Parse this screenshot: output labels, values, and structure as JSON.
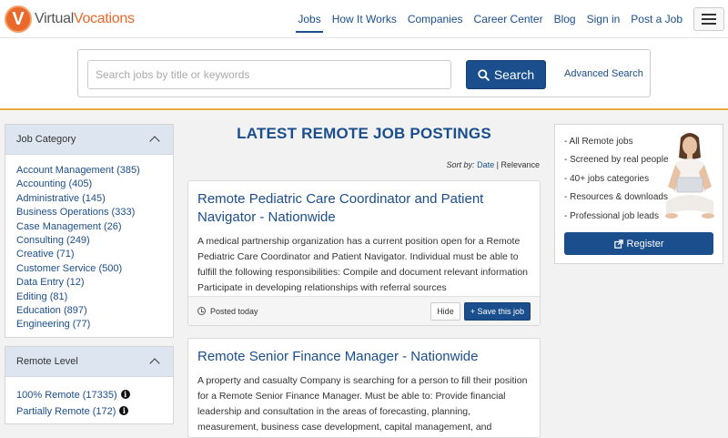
{
  "header": {
    "logo_letter": "V",
    "logo_virtual": "Virtual",
    "logo_vocations": "Vocations",
    "nav": [
      "Jobs",
      "How It Works",
      "Companies",
      "Career Center",
      "Blog",
      "Sign in",
      "Post a Job"
    ],
    "active_nav": "Jobs",
    "menu_icon": "hamburger-icon"
  },
  "search": {
    "placeholder": "Search jobs by title or keywords",
    "value": "",
    "button_label": "Search",
    "button_icon": "search-icon",
    "advanced_label": "Advanced Search"
  },
  "sidebar": {
    "category_title": "Job Category",
    "categories": [
      "Account Management (385)",
      "Accounting (405)",
      "Administrative (145)",
      "Business Operations (333)",
      "Case Management (26)",
      "Consulting (249)",
      "Creative (71)",
      "Customer Service (500)",
      "Data Entry (12)",
      "Editing (81)",
      "Education (897)",
      "Engineering (77)"
    ],
    "remote_title": "Remote Level",
    "remote_levels": [
      "100% Remote (17335)",
      "Partially Remote (172)"
    ],
    "info_glyph": "i"
  },
  "main": {
    "title": "LATEST REMOTE JOB POSTINGS",
    "sort_label": "Sort by:",
    "sort_options": [
      "Date",
      "Relevance"
    ],
    "sort_separator": "|",
    "jobs": [
      {
        "title": "Remote Pediatric Care Coordinator and Patient Navigator - Nationwide",
        "description": "A medical partnership organization has a current position open for a Remote Pediatric Care Coordinator and Patient Navigator. Individual must be able to fulfill the following responsibilities: Compile and document relevant information Participate in developing relationships with referral sources",
        "posted": "Posted today",
        "hide_label": "Hide",
        "save_label": "+ Save this job"
      },
      {
        "title": "Remote Senior Finance Manager - Nationwide",
        "description": "A property and casualty Company is searching for a person to fill their position for a Remote Senior Finance Manager. Must be able to: Provide financial leadership and consultation in the areas of forecasting, planning, measurement, business case development, capital management, and"
      }
    ]
  },
  "promo": {
    "items": [
      "- All Remote jobs",
      "- Screened by real people",
      "- 40+ jobs categories",
      "- Resources & downloads",
      "- Professional job leads"
    ],
    "register_label": "Register",
    "register_icon": "external-link-icon"
  },
  "colors": {
    "brand_blue": "#1a4e8c",
    "brand_orange": "#e8692a",
    "accent_gold": "#e3b23c",
    "panel_header": "#dde6f0"
  }
}
